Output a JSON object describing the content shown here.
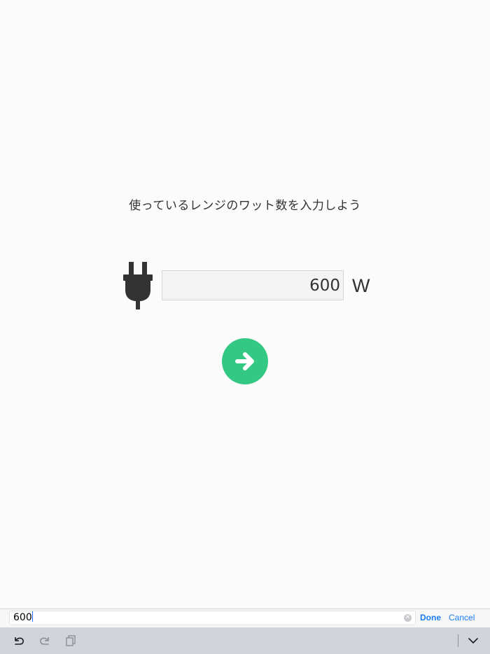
{
  "main": {
    "prompt": "使っているレンジのワット数を入力しよう",
    "wattage_value": "600",
    "unit": "W"
  },
  "icons": {
    "plug": "plug-icon",
    "next": "arrow-right-circle-icon",
    "undo": "undo-icon",
    "redo": "redo-icon",
    "paste": "paste-icon",
    "dismiss": "chevron-down-icon",
    "clear": "clear-icon"
  },
  "colors": {
    "accent_green": "#33c884",
    "ios_blue": "#1a7cf5",
    "text": "#333333"
  },
  "accessory": {
    "field_value": "600",
    "done_label": "Done",
    "cancel_label": "Cancel"
  }
}
